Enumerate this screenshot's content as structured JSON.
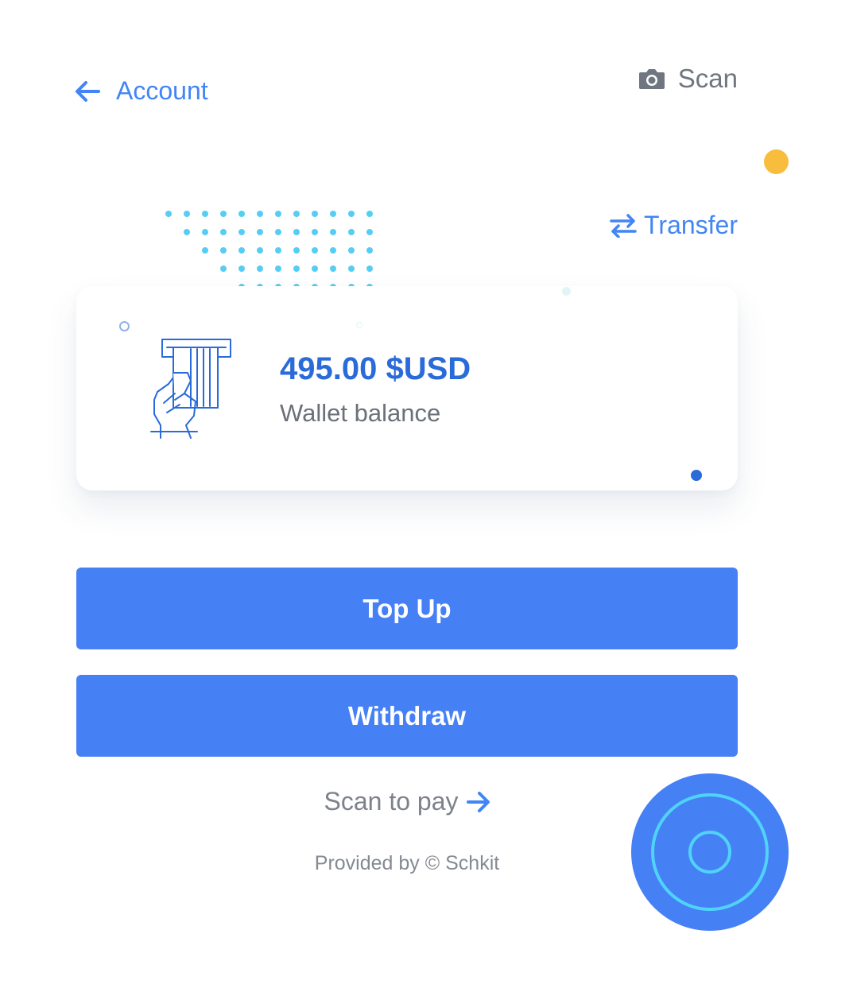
{
  "header": {
    "back_label": "Account",
    "scan_label": "Scan"
  },
  "transfer": {
    "label": "Transfer"
  },
  "wallet": {
    "amount": "495.00 $USD",
    "label": "Wallet balance"
  },
  "actions": {
    "top_up": "Top Up",
    "withdraw": "Withdraw"
  },
  "scan_to_pay": {
    "label": "Scan to pay"
  },
  "footer": {
    "credit": "Provided by © Schkit"
  },
  "icons": {
    "back": "arrow-left-icon",
    "scan": "camera-icon",
    "transfer": "swap-arrows-icon",
    "scan_to_pay": "arrow-right-icon",
    "fab": "target-circle-icon",
    "card": "card-payment-illustration"
  },
  "colors": {
    "accent": "#4285f4",
    "button": "#4680f5",
    "amount": "#2a6bd9",
    "muted_text": "#6f7680",
    "yellow_dot": "#f8bd3d",
    "dot_grid": "#56cdf4",
    "fab_ring": "#4fd3f8"
  }
}
